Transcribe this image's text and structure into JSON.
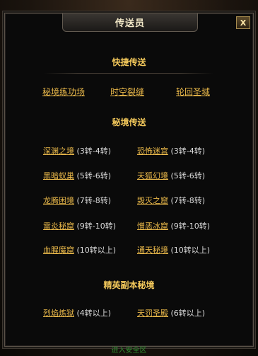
{
  "window": {
    "title": "传送员",
    "close_label": "X"
  },
  "quick": {
    "title": "快捷传送",
    "links": [
      "秘境练功场",
      "时空裂缝",
      "轮回圣域"
    ]
  },
  "secret": {
    "title": "秘境传送",
    "rows": [
      [
        {
          "name": "深渊之境",
          "req": "(3转-4转)"
        },
        {
          "name": "恐怖迷宫",
          "req": "(3转-4转)"
        }
      ],
      [
        {
          "name": "黑暗蚁巢",
          "req": "(5转-6转)"
        },
        {
          "name": "天狐幻境",
          "req": "(5转-6转)"
        }
      ],
      [
        {
          "name": "龙腾困境",
          "req": "(7转-8转)"
        },
        {
          "name": "毁灭之窟",
          "req": "(7转-8转)"
        }
      ],
      [
        {
          "name": "雷炎秘窟",
          "req": "(9转-10转)"
        },
        {
          "name": "憎恶冰窟",
          "req": "(9转-10转)"
        }
      ],
      [
        {
          "name": "血腥魔窟",
          "req": "(10转以上)"
        },
        {
          "name": "通天秘境",
          "req": "(10转以上)"
        }
      ]
    ]
  },
  "elite": {
    "title": "精英副本秘境",
    "rows": [
      [
        {
          "name": "烈焰炼狱",
          "req": "(4转以上)"
        },
        {
          "name": "天罚圣殿",
          "req": "(6转以上)"
        }
      ]
    ]
  },
  "footer": {
    "text": "进入安全区"
  },
  "colors": {
    "link": "#e9b84a",
    "section_title": "#f5ca5c",
    "requirement": "#dcdcdc"
  }
}
